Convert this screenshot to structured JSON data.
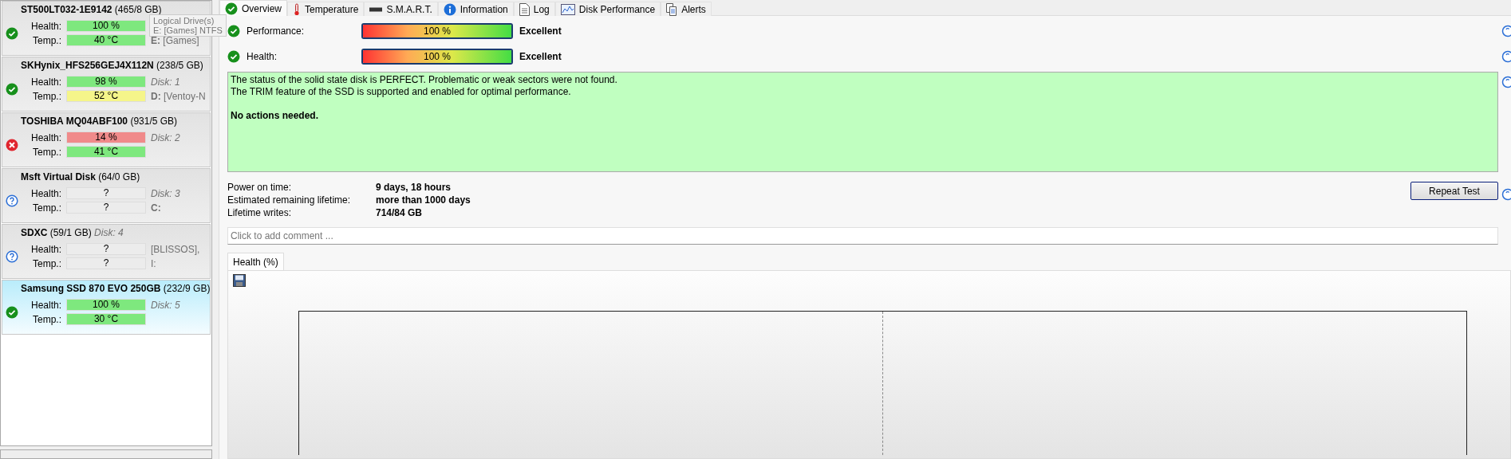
{
  "disks": [
    {
      "name": "ST500LT032-1E9142",
      "size": "(465/8 GB)",
      "kind": "ok",
      "selected": false,
      "health_label": "Health:",
      "temp_label": "Temp.:",
      "health": {
        "text": "100 %",
        "color": "#7ee87e"
      },
      "temp": {
        "text": "40 °C",
        "color": "#7ee87e"
      },
      "temp_note": "**E:** [Games]",
      "tooltip": [
        "Logical Drive(s)",
        "E: [Games] NTFS"
      ]
    },
    {
      "name": "SKHynix_HFS256GEJ4X112N",
      "size": "(238/5 GB)",
      "kind": "ok",
      "selected": false,
      "health_label": "Health:",
      "temp_label": "Temp.:",
      "health": {
        "text": "98 %",
        "color": "#7ee87e"
      },
      "temp": {
        "text": "52 °C",
        "color": "#f5f58a"
      },
      "health_note": "Disk: 1",
      "temp_note": "**D:** [Ventoy-N"
    },
    {
      "name": "TOSHIBA MQ04ABF100",
      "size": "(931/5 GB)",
      "kind": "error",
      "selected": false,
      "health_label": "Health:",
      "temp_label": "Temp.:",
      "health": {
        "text": "14 %",
        "color": "#f08a8a"
      },
      "temp": {
        "text": "41 °C",
        "color": "#7ee87e"
      },
      "health_note": "Disk: 2"
    },
    {
      "name": "Msft    Virtual Disk",
      "size": "(64/0 GB)",
      "kind": "unknown",
      "selected": false,
      "health_label": "Health:",
      "temp_label": "Temp.:",
      "health": {
        "text": "?",
        "color": "#ececec"
      },
      "temp": {
        "text": "?",
        "color": "#ececec"
      },
      "health_note": "Disk: 3",
      "temp_note": "**C:**"
    },
    {
      "name": "SDXC",
      "size": "(59/1 GB)",
      "title_note": "Disk: 4",
      "kind": "unknown",
      "selected": false,
      "health_label": "Health:",
      "temp_label": "Temp.:",
      "health": {
        "text": "?",
        "color": "#ececec"
      },
      "temp": {
        "text": "?",
        "color": "#ececec"
      },
      "health_note": "[BLISSOS],",
      "temp_note": "I:"
    },
    {
      "name": "Samsung SSD 870 EVO 250GB",
      "size": "(232/9 GB)",
      "kind": "ok",
      "selected": true,
      "health_label": "Health:",
      "temp_label": "Temp.:",
      "health": {
        "text": "100 %",
        "color": "#7ee87e"
      },
      "temp": {
        "text": "30 °C",
        "color": "#7ee87e"
      },
      "health_note": "Disk: 5"
    }
  ],
  "tabs": [
    {
      "label": "Overview",
      "selected": true
    },
    {
      "label": "Temperature",
      "selected": false
    },
    {
      "label": "S.M.A.R.T.",
      "selected": false
    },
    {
      "label": "Information",
      "selected": false
    },
    {
      "label": "Log",
      "selected": false
    },
    {
      "label": "Disk Performance",
      "selected": false
    },
    {
      "label": "Alerts",
      "selected": false
    }
  ],
  "meters": [
    {
      "label": "Performance:",
      "kind": "ok",
      "level": 1,
      "reading": "100 %",
      "rating": "Excellent"
    },
    {
      "label": "Health:",
      "kind": "ok",
      "level": 1,
      "reading": "100 %",
      "rating": "Excellent"
    }
  ],
  "status_text": {
    "lines": [
      "The status of the solid state disk is PERFECT. Problematic or weak sectors were not found.",
      "The TRIM feature of the SSD is supported and enabled for optimal performance."
    ],
    "action": "No actions needed."
  },
  "info": [
    {
      "label": "Power on time:",
      "value": "9 days, 18 hours"
    },
    {
      "label": "Estimated remaining lifetime:",
      "value": "more than 1000 days"
    },
    {
      "label": "Lifetime writes:",
      "value": "714/84 GB"
    }
  ],
  "repeat_button": "Repeat Test",
  "comment": {
    "placeholder": "Click to add comment ..."
  },
  "chart_tabs": [
    {
      "label": "Health (%)",
      "selected": true
    }
  ]
}
